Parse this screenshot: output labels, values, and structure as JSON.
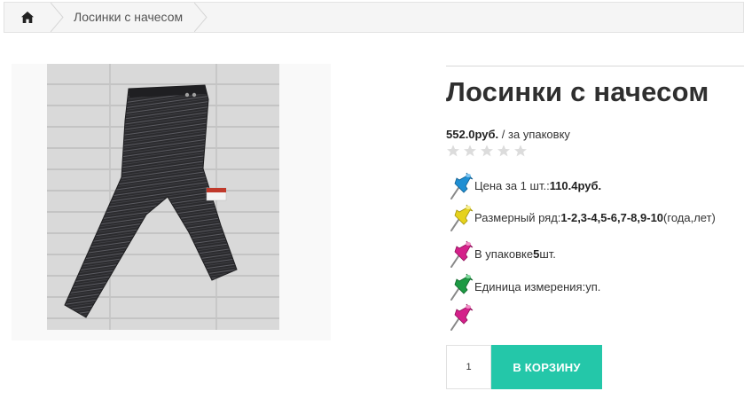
{
  "breadcrumb": {
    "home_icon": "home-icon",
    "current": "Лосинки с начесом"
  },
  "product": {
    "image_alt": "Лосинки с начесом",
    "image_tag_text": "MADE IN TURKEY",
    "title": "Лосинки с начесом",
    "price": "552.0руб.",
    "price_unit": " / за упаковку",
    "rating": {
      "filled": 0,
      "max": 5,
      "icon": "star-icon"
    },
    "attributes": [
      {
        "pin_color": "#1f8fd3",
        "label": "Цена за 1 шт.: ",
        "value": "110.4руб.",
        "suffix": ""
      },
      {
        "pin_color": "#e6d21c",
        "label": "Размерный ряд:",
        "value": "1-2,3-4,5-6,7-8,9-10",
        "suffix": " (года,лет)"
      },
      {
        "pin_color": "#d4208a",
        "label": "В упаковке ",
        "value": "5",
        "suffix": " шт."
      },
      {
        "pin_color": "#1e9a44",
        "label": "Единица измерения: ",
        "value": "",
        "suffix": "уп."
      },
      {
        "pin_color": "#d4208a",
        "label": "",
        "value": "",
        "suffix": ""
      }
    ],
    "quantity": "1",
    "add_to_cart_label": "В КОРЗИНУ"
  },
  "colors": {
    "accent": "#24c7a9",
    "breadcrumb_bg": "#f5f5f5",
    "title": "#2f2f2f"
  }
}
